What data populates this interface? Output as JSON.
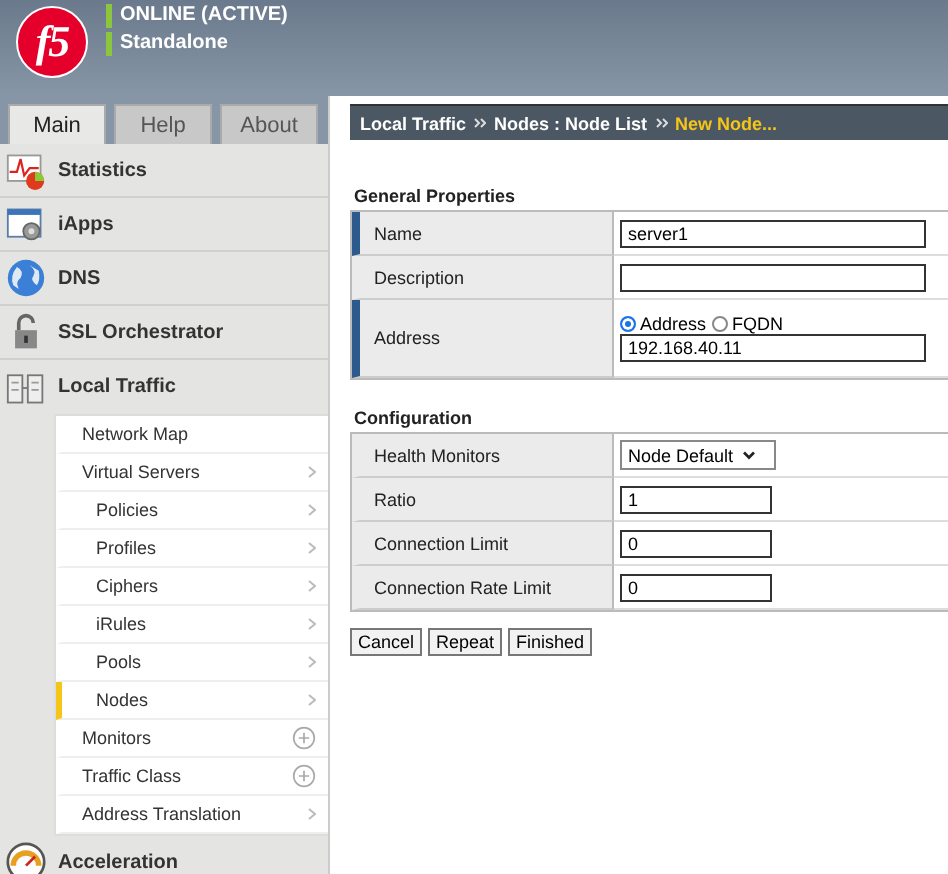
{
  "header": {
    "logo": "f5",
    "status": [
      "ONLINE (ACTIVE)",
      "Standalone"
    ]
  },
  "tabs": [
    {
      "label": "Main",
      "selected": true
    },
    {
      "label": "Help",
      "selected": false
    },
    {
      "label": "About",
      "selected": false
    }
  ],
  "breadcrumb": {
    "path": [
      "Local Traffic",
      "Nodes : Node List"
    ],
    "current": "New Node..."
  },
  "sidebar": {
    "sections": [
      {
        "label": "Statistics",
        "expanded": false
      },
      {
        "label": "iApps",
        "expanded": false
      },
      {
        "label": "DNS",
        "expanded": false
      },
      {
        "label": "SSL Orchestrator",
        "expanded": false
      },
      {
        "label": "Local Traffic",
        "expanded": true,
        "items": [
          {
            "label": "Network Map",
            "kind": "link",
            "selected": false
          },
          {
            "label": "Virtual Servers",
            "kind": "submenu",
            "selected": false,
            "children": [
              {
                "label": "Policies",
                "kind": "submenu",
                "selected": false
              },
              {
                "label": "Profiles",
                "kind": "submenu",
                "selected": false
              },
              {
                "label": "Ciphers",
                "kind": "submenu",
                "selected": false
              },
              {
                "label": "iRules",
                "kind": "submenu",
                "selected": false
              },
              {
                "label": "Pools",
                "kind": "submenu",
                "selected": false
              },
              {
                "label": "Nodes",
                "kind": "submenu",
                "selected": true
              }
            ]
          },
          {
            "label": "Monitors",
            "kind": "add",
            "selected": false
          },
          {
            "label": "Traffic Class",
            "kind": "add",
            "selected": false
          },
          {
            "label": "Address Translation",
            "kind": "submenu",
            "selected": false
          }
        ]
      },
      {
        "label": "Acceleration",
        "expanded": false
      }
    ]
  },
  "general": {
    "title": "General Properties",
    "rows": [
      {
        "label": "Name",
        "required": true,
        "kind": "text",
        "value": "server1"
      },
      {
        "label": "Description",
        "required": false,
        "kind": "text",
        "value": ""
      },
      {
        "label": "Address",
        "required": true,
        "kind": "address",
        "options": [
          {
            "label": "Address",
            "selected": true
          },
          {
            "label": "FQDN",
            "selected": false
          }
        ],
        "value": "192.168.40.11"
      }
    ]
  },
  "configuration": {
    "title": "Configuration",
    "rows": [
      {
        "label": "Health Monitors",
        "kind": "select",
        "value": "Node Default"
      },
      {
        "label": "Ratio",
        "kind": "text",
        "value": "1"
      },
      {
        "label": "Connection Limit",
        "kind": "text",
        "value": "0"
      },
      {
        "label": "Connection Rate Limit",
        "kind": "text",
        "value": "0"
      }
    ]
  },
  "buttons": [
    "Cancel",
    "Repeat",
    "Finished"
  ]
}
